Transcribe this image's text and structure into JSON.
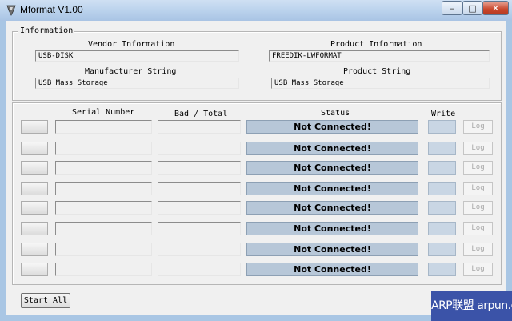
{
  "window": {
    "title": "Mformat V1.00",
    "controls": {
      "minimize": "–",
      "maximize": "□",
      "close": "✕"
    }
  },
  "info": {
    "group_label": "Information",
    "vendor_label": "Vendor Information",
    "vendor_value": "USB-DISK",
    "product_label": "Product Information",
    "product_value": "FREEDIK-LWFORMAT",
    "manufacturer_label": "Manufacturer String",
    "manufacturer_value": "USB Mass Storage",
    "product_string_label": "Product String",
    "product_string_value": "USB Mass Storage"
  },
  "table": {
    "headers": {
      "serial": "Serial Number",
      "bad_total": "Bad / Total",
      "status": "Status",
      "write": "Write"
    },
    "rows": [
      {
        "status": "Not Connected!",
        "log": "Log"
      },
      {
        "status": "Not Connected!",
        "log": "Log"
      },
      {
        "status": "Not Connected!",
        "log": "Log"
      },
      {
        "status": "Not Connected!",
        "log": "Log"
      },
      {
        "status": "Not Connected!",
        "log": "Log"
      },
      {
        "status": "Not Connected!",
        "log": "Log"
      },
      {
        "status": "Not Connected!",
        "log": "Log"
      },
      {
        "status": "Not Connected!",
        "log": "Log"
      }
    ]
  },
  "actions": {
    "start_all": "Start All"
  },
  "watermark": "ARP联盟 arpun.com",
  "colors": {
    "status_bg": "#b7c7d8",
    "titlebar": "#b9d1ec",
    "watermark_bg": "#3b53a8"
  }
}
